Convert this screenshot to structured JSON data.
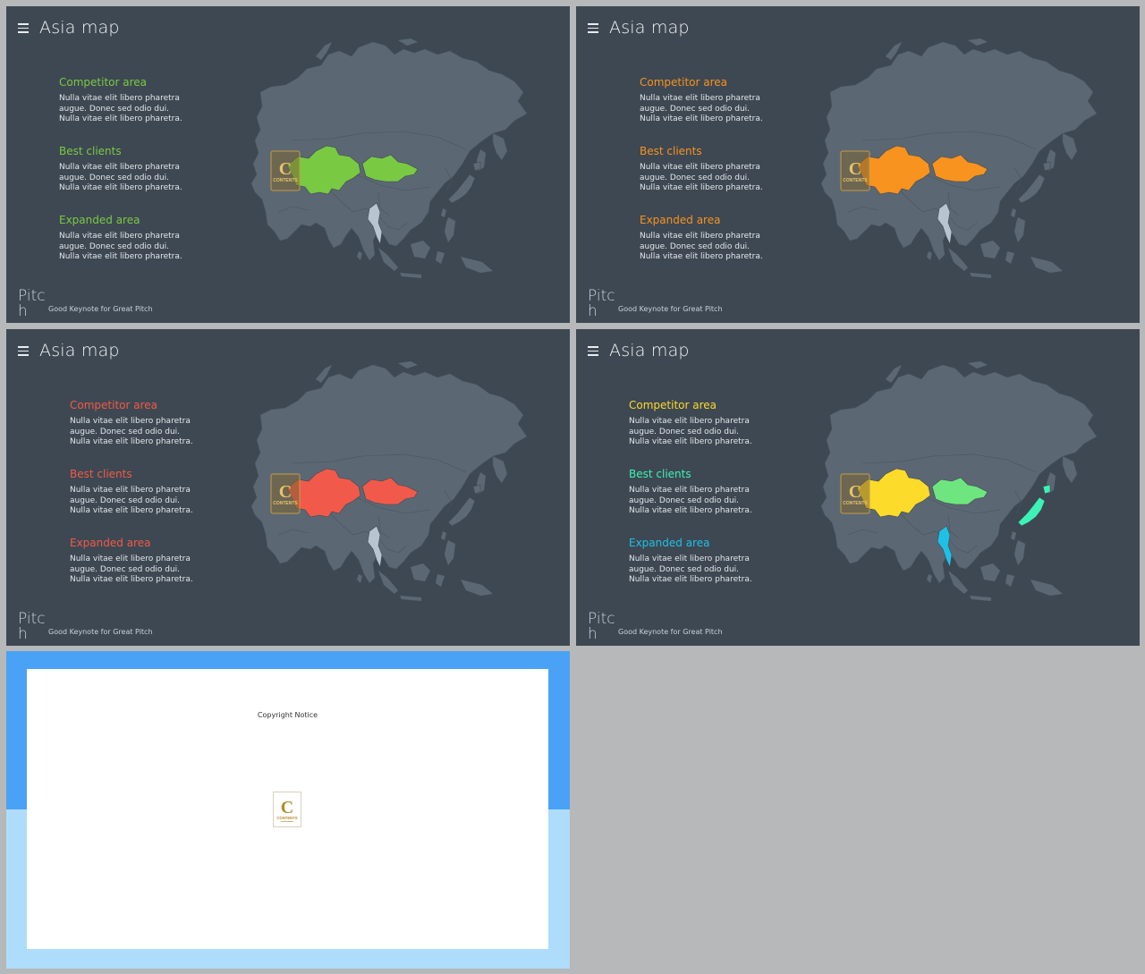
{
  "slides": [
    {
      "title": "Asia map",
      "colors": {
        "competitor": "#7ac943",
        "best": "#7ac943",
        "expanded": "#7ac943",
        "region_west": "#7ac943",
        "region_east": "#7ac943",
        "region_japan": "#5d6a76",
        "region_myanmar": "#b8c4ce"
      },
      "items": [
        {
          "heading": "Competitor area",
          "body": [
            "Nulla vitae elit libero pharetra",
            "augue. Donec sed odio dui.",
            "Nulla vitae elit libero pharetra."
          ]
        },
        {
          "heading": "Best clients",
          "body": [
            "Nulla vitae elit libero pharetra",
            "augue. Donec sed odio dui.",
            "Nulla vitae elit libero pharetra."
          ]
        },
        {
          "heading": "Expanded area",
          "body": [
            "Nulla vitae elit libero pharetra",
            "augue. Donec sed odio dui.",
            "Nulla vitae elit libero pharetra."
          ]
        }
      ],
      "brand": "Pitch",
      "tagline": "Good Keynote for Great Pitch"
    },
    {
      "title": "Asia map",
      "colors": {
        "competitor": "#f7931e",
        "best": "#f7931e",
        "expanded": "#f7931e",
        "region_west": "#f7931e",
        "region_east": "#f7931e",
        "region_japan": "#5d6a76",
        "region_myanmar": "#b8c4ce"
      },
      "items": [
        {
          "heading": "Competitor area",
          "body": [
            "Nulla vitae elit libero pharetra",
            "augue. Donec sed odio dui.",
            "Nulla vitae elit libero pharetra."
          ]
        },
        {
          "heading": "Best clients",
          "body": [
            "Nulla vitae elit libero pharetra",
            "augue. Donec sed odio dui.",
            "Nulla vitae elit libero pharetra."
          ]
        },
        {
          "heading": "Expanded area",
          "body": [
            "Nulla vitae elit libero pharetra",
            "augue. Donec sed odio dui.",
            "Nulla vitae elit libero pharetra."
          ]
        }
      ],
      "brand": "Pitch",
      "tagline": "Good Keynote for Great Pitch"
    },
    {
      "title": "Asia map",
      "colors": {
        "competitor": "#f15a4a",
        "best": "#f15a4a",
        "expanded": "#f15a4a",
        "region_west": "#f15a4a",
        "region_east": "#f15a4a",
        "region_japan": "#5d6a76",
        "region_myanmar": "#b8c4ce"
      },
      "items": [
        {
          "heading": "Competitor area",
          "body": [
            "Nulla vitae elit libero pharetra",
            "augue. Donec sed odio dui.",
            "Nulla vitae elit libero pharetra."
          ]
        },
        {
          "heading": "Best clients",
          "body": [
            "Nulla vitae elit libero pharetra",
            "augue. Donec sed odio dui.",
            "Nulla vitae elit libero pharetra."
          ]
        },
        {
          "heading": "Expanded area",
          "body": [
            "Nulla vitae elit libero pharetra",
            "augue. Donec sed odio dui.",
            "Nulla vitae elit libero pharetra."
          ]
        }
      ],
      "brand": "Pitch",
      "tagline": "Good Keynote for Great Pitch"
    },
    {
      "title": "Asia map",
      "colors": {
        "competitor": "#fcd92c",
        "best": "#3df2b5",
        "expanded": "#1fc0e6",
        "region_west": "#fcdb2a",
        "region_east": "#6fe57f",
        "region_japan": "#3df2b5",
        "region_myanmar": "#1fc0e6"
      },
      "items": [
        {
          "heading": "Competitor area",
          "body": [
            "Nulla vitae elit libero pharetra",
            "augue. Donec sed odio dui.",
            "Nulla vitae elit libero pharetra."
          ]
        },
        {
          "heading": "Best clients",
          "body": [
            "Nulla vitae elit libero pharetra",
            "augue. Donec sed odio dui.",
            "Nulla vitae elit libero pharetra."
          ]
        },
        {
          "heading": "Expanded area",
          "body": [
            "Nulla vitae elit libero pharetra",
            "augue. Donec sed odio dui.",
            "Nulla vitae elit libero pharetra."
          ]
        }
      ],
      "brand": "Pitch",
      "tagline": "Good Keynote for Great Pitch"
    }
  ],
  "copyright": {
    "title": "Copyright Notice",
    "logo_letter": "C",
    "logo_text": "CONTENTS"
  },
  "logo_badge": {
    "letter": "C",
    "text": "CONTENTS"
  }
}
